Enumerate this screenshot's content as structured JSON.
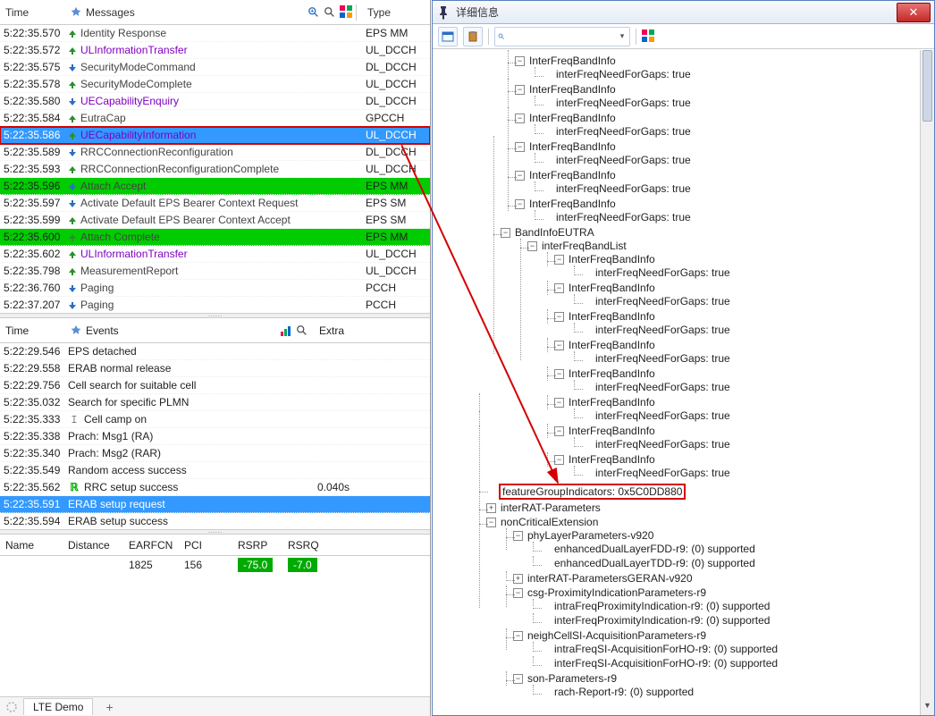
{
  "messages_pane": {
    "headers": {
      "time": "Time",
      "messages": "Messages",
      "type": "Type"
    },
    "rows": [
      {
        "time": "5:22:35.570",
        "dir": "up",
        "txt": "Identity Response",
        "purple": false,
        "type": "EPS MM"
      },
      {
        "time": "5:22:35.572",
        "dir": "up",
        "txt": "ULInformationTransfer",
        "purple": true,
        "type": "UL_DCCH"
      },
      {
        "time": "5:22:35.575",
        "dir": "down",
        "txt": "SecurityModeCommand",
        "purple": false,
        "type": "DL_DCCH"
      },
      {
        "time": "5:22:35.578",
        "dir": "up",
        "txt": "SecurityModeComplete",
        "purple": false,
        "type": "UL_DCCH"
      },
      {
        "time": "5:22:35.580",
        "dir": "down",
        "txt": "UECapabilityEnquiry",
        "purple": true,
        "type": "DL_DCCH"
      },
      {
        "time": "5:22:35.584",
        "dir": "up",
        "txt": "EutraCap",
        "purple": false,
        "type": "GPCCH"
      },
      {
        "time": "5:22:35.586",
        "dir": "up",
        "txt": "UECapabilityInformation",
        "purple": true,
        "type": "UL_DCCH",
        "selected": true,
        "redbox": true
      },
      {
        "time": "5:22:35.589",
        "dir": "down",
        "txt": "RRCConnectionReconfiguration",
        "purple": false,
        "type": "DL_DCCH"
      },
      {
        "time": "5:22:35.593",
        "dir": "up",
        "txt": "RRCConnectionReconfigurationComplete",
        "purple": false,
        "type": "UL_DCCH"
      },
      {
        "time": "5:22:35.596",
        "dir": "down",
        "txt": "Attach Accept",
        "purple": false,
        "type": "EPS MM",
        "green": true
      },
      {
        "time": "5:22:35.597",
        "dir": "down",
        "txt": "Activate Default EPS Bearer Context Request",
        "purple": false,
        "type": "EPS SM"
      },
      {
        "time": "5:22:35.599",
        "dir": "up",
        "txt": "Activate Default EPS Bearer Context Accept",
        "purple": false,
        "type": "EPS SM"
      },
      {
        "time": "5:22:35.600",
        "dir": "up",
        "txt": "Attach Complete",
        "purple": false,
        "type": "EPS MM",
        "green": true
      },
      {
        "time": "5:22:35.602",
        "dir": "up",
        "txt": "ULInformationTransfer",
        "purple": true,
        "type": "UL_DCCH"
      },
      {
        "time": "5:22:35.798",
        "dir": "up",
        "txt": "MeasurementReport",
        "purple": false,
        "type": "UL_DCCH"
      },
      {
        "time": "5:22:36.760",
        "dir": "down",
        "txt": "Paging",
        "purple": false,
        "type": "PCCH"
      },
      {
        "time": "5:22:37.207",
        "dir": "down",
        "txt": "Paging",
        "purple": false,
        "type": "PCCH"
      }
    ]
  },
  "events_pane": {
    "headers": {
      "time": "Time",
      "events": "Events",
      "extra": "Extra"
    },
    "rows": [
      {
        "time": "5:22:29.546",
        "ev": "EPS detached",
        "extra": ""
      },
      {
        "time": "5:22:29.558",
        "ev": "ERAB normal release",
        "extra": ""
      },
      {
        "time": "5:22:29.756",
        "ev": "Cell search for suitable cell",
        "extra": ""
      },
      {
        "time": "5:22:35.032",
        "ev": "Search for specific PLMN",
        "extra": ""
      },
      {
        "time": "5:22:35.333",
        "ev": "Cell camp on",
        "extra": "",
        "icon": "cursor"
      },
      {
        "time": "5:22:35.338",
        "ev": "Prach: Msg1 (RA)",
        "extra": ""
      },
      {
        "time": "5:22:35.340",
        "ev": "Prach: Msg2 (RAR)",
        "extra": ""
      },
      {
        "time": "5:22:35.549",
        "ev": "Random access success",
        "extra": ""
      },
      {
        "time": "5:22:35.562",
        "ev": "RRC setup success",
        "extra": "0.040s",
        "icon": "R"
      },
      {
        "time": "5:22:35.591",
        "ev": "ERAB setup request",
        "extra": "",
        "selected": true
      },
      {
        "time": "5:22:35.594",
        "ev": "ERAB setup success",
        "extra": ""
      }
    ]
  },
  "cells_pane": {
    "headers": {
      "name": "Name",
      "dist": "Distance",
      "earfcn": "EARFCN",
      "pci": "PCI",
      "rsrp": "RSRP",
      "rsrq": "RSRQ"
    },
    "rows": [
      {
        "name": "",
        "dist": "",
        "earfcn": "1825",
        "pci": "156",
        "rsrp": "-75.0",
        "rsrq": "-7.0"
      }
    ]
  },
  "tabs": {
    "main": "LTE Demo",
    "add": "+"
  },
  "right_pane": {
    "title": "详细信息",
    "toolbar": {
      "search_placeholder": ""
    },
    "tree": [
      {
        "label": "InterFreqBandInfo",
        "children": [
          {
            "label": "interFreqNeedForGaps: true"
          }
        ]
      },
      {
        "label": "InterFreqBandInfo",
        "children": [
          {
            "label": "interFreqNeedForGaps: true"
          }
        ]
      },
      {
        "label": "InterFreqBandInfo",
        "children": [
          {
            "label": "interFreqNeedForGaps: true"
          }
        ]
      },
      {
        "label": "InterFreqBandInfo",
        "children": [
          {
            "label": "interFreqNeedForGaps: true"
          }
        ]
      },
      {
        "label": "InterFreqBandInfo",
        "children": [
          {
            "label": "interFreqNeedForGaps: true"
          }
        ]
      },
      {
        "label": "InterFreqBandInfo",
        "children": [
          {
            "label": "interFreqNeedForGaps: true"
          }
        ]
      },
      {
        "label": "BandInfoEUTRA",
        "level": -1,
        "children": [
          {
            "label": "interFreqBandList",
            "children": [
              {
                "label": "InterFreqBandInfo",
                "children": [
                  {
                    "label": "interFreqNeedForGaps: true"
                  }
                ]
              },
              {
                "label": "InterFreqBandInfo",
                "children": [
                  {
                    "label": "interFreqNeedForGaps: true"
                  }
                ]
              },
              {
                "label": "InterFreqBandInfo",
                "children": [
                  {
                    "label": "interFreqNeedForGaps: true"
                  }
                ]
              },
              {
                "label": "InterFreqBandInfo",
                "children": [
                  {
                    "label": "interFreqNeedForGaps: true"
                  }
                ]
              },
              {
                "label": "InterFreqBandInfo",
                "children": [
                  {
                    "label": "interFreqNeedForGaps: true"
                  }
                ]
              },
              {
                "label": "InterFreqBandInfo",
                "children": [
                  {
                    "label": "interFreqNeedForGaps: true"
                  }
                ]
              },
              {
                "label": "InterFreqBandInfo",
                "children": [
                  {
                    "label": "interFreqNeedForGaps: true"
                  }
                ]
              },
              {
                "label": "InterFreqBandInfo",
                "children": [
                  {
                    "label": "interFreqNeedForGaps: true"
                  }
                ]
              }
            ]
          }
        ]
      },
      {
        "label": "featureGroupIndicators: 0x5C0DD880",
        "leaf": true,
        "boxed": true,
        "level": -2
      },
      {
        "label": "interRAT-Parameters",
        "leaf": true,
        "closed": true,
        "level": -2
      },
      {
        "label": "nonCriticalExtension",
        "level": -2,
        "children": [
          {
            "label": "phyLayerParameters-v920",
            "children": [
              {
                "label": "enhancedDualLayerFDD-r9: (0) supported"
              },
              {
                "label": "enhancedDualLayerTDD-r9: (0) supported"
              }
            ]
          },
          {
            "label": "interRAT-ParametersGERAN-v920",
            "leaf": true,
            "closed": true
          },
          {
            "label": "csg-ProximityIndicationParameters-r9",
            "children": [
              {
                "label": "intraFreqProximityIndication-r9: (0) supported"
              },
              {
                "label": "interFreqProximityIndication-r9: (0) supported"
              }
            ]
          },
          {
            "label": "neighCellSI-AcquisitionParameters-r9",
            "children": [
              {
                "label": "intraFreqSI-AcquisitionForHO-r9: (0) supported"
              },
              {
                "label": "interFreqSI-AcquisitionForHO-r9: (0) supported"
              }
            ]
          },
          {
            "label": "son-Parameters-r9",
            "children": [
              {
                "label": "rach-Report-r9: (0) supported"
              }
            ]
          }
        ]
      }
    ]
  }
}
